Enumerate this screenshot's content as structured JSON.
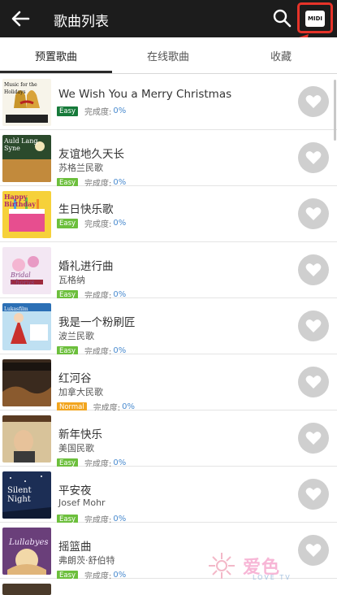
{
  "header": {
    "title": "歌曲列表",
    "midi_label": "MIDI"
  },
  "tabs": [
    {
      "label": "预置歌曲",
      "active": true
    },
    {
      "label": "在线歌曲",
      "active": false
    },
    {
      "label": "收藏",
      "active": false
    }
  ],
  "progress_label": "完成度:",
  "songs": [
    {
      "name": "We Wish You a Merry Christmas",
      "artist": "",
      "level": "Easy",
      "progress": "0%",
      "cover_text": "Music for the Holidays"
    },
    {
      "name": "友谊地久天长",
      "artist": "苏格兰民歌",
      "level": "Easy",
      "progress": "0%",
      "cover_text": "Auld Lang Syne"
    },
    {
      "name": "生日快乐歌",
      "artist": "",
      "level": "Easy",
      "progress": "0%",
      "cover_text": "Happy Birthday"
    },
    {
      "name": "婚礼进行曲",
      "artist": "瓦格纳",
      "level": "Easy",
      "progress": "0%",
      "cover_text": "Bridal Chorus"
    },
    {
      "name": "我是一个粉刷匠",
      "artist": "波兰民歌",
      "level": "Easy",
      "progress": "0%",
      "cover_text": "Lukasfilm"
    },
    {
      "name": "红河谷",
      "artist": "加拿大民歌",
      "level": "Normal",
      "progress": "0%",
      "cover_text": ""
    },
    {
      "name": "新年快乐",
      "artist": "美国民歌",
      "level": "Easy",
      "progress": "0%",
      "cover_text": ""
    },
    {
      "name": "平安夜",
      "artist": "Josef Mohr",
      "level": "Easy",
      "progress": "0%",
      "cover_text": "Silent Night"
    },
    {
      "name": "摇篮曲",
      "artist": "弗朗茨·舒伯特",
      "level": "Easy",
      "progress": "0%",
      "cover_text": "Lullabyes"
    }
  ],
  "watermark": {
    "main": "爱色",
    "sub": "LOVE TV"
  },
  "colors": {
    "topbar": "#1c1c1c",
    "highlight": "#e63329",
    "easy": "#6cbf3c",
    "normal": "#f2a51f",
    "progress": "#4a8bcf"
  }
}
